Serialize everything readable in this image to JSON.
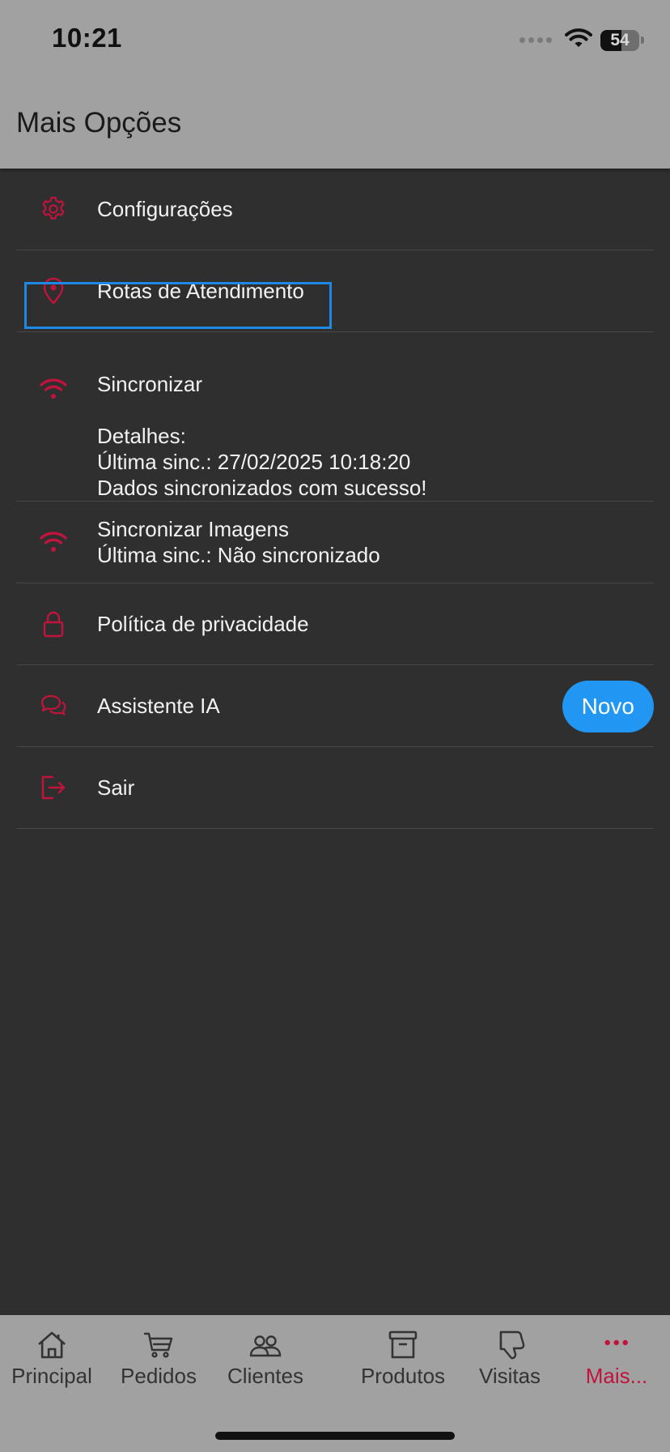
{
  "status_bar": {
    "time": "10:21",
    "battery_percent": "54",
    "battery_level": 0.54
  },
  "header": {
    "title": "Mais Opções"
  },
  "colors": {
    "accent": "#c0143c",
    "badge": "#2196f3",
    "highlight_border": "#1e88e5",
    "background": "#2f2f2f",
    "bars": "#a1a1a1"
  },
  "menu": {
    "settings": {
      "label": "Configurações",
      "icon": "gear-icon"
    },
    "routes": {
      "label": "Rotas de Atendimento",
      "icon": "map-pin-icon"
    },
    "sync": {
      "label": "Sincronizar",
      "icon": "wifi-icon",
      "details_title": "Detalhes:",
      "last_sync": "Última sinc.: 27/02/2025 10:18:20",
      "status": "Dados sincronizados com sucesso!"
    },
    "sync_images": {
      "label": "Sincronizar Imagens",
      "icon": "wifi-icon",
      "last_sync": "Última sinc.: Não sincronizado"
    },
    "privacy": {
      "label": "Política de privacidade",
      "icon": "lock-icon"
    },
    "assistant": {
      "label": "Assistente IA",
      "icon": "chat-bubbles-icon",
      "badge": "Novo"
    },
    "logout": {
      "label": "Sair",
      "icon": "logout-icon"
    }
  },
  "tabs": [
    {
      "label": "Principal",
      "icon": "home-icon"
    },
    {
      "label": "Pedidos",
      "icon": "cart-icon"
    },
    {
      "label": "Clientes",
      "icon": "users-icon"
    },
    {
      "label": "Produtos",
      "icon": "archive-box-icon"
    },
    {
      "label": "Visitas",
      "icon": "thumbs-down-icon"
    },
    {
      "label": "Mais...",
      "icon": "more-dots-icon",
      "active": true
    }
  ]
}
